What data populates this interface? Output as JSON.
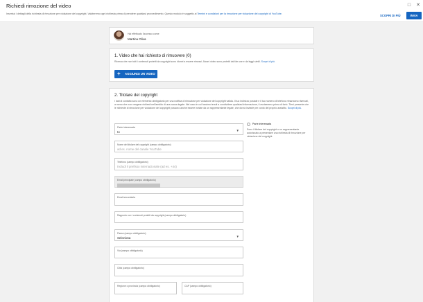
{
  "header": {
    "title": "Richiedi rimozione del video",
    "subtitle": "Inserisci i dettagli della richiesta di rimozione per violazione del copyright. Valuteremo ogni richiesta prima di prendere qualsiasi provvedimento. Questo modulo è soggetto ai ",
    "terms_link": "Termini e condizioni per la rimozione per violazione del copyright di YouTube.",
    "draft_button": "SCOPRI DI PIÙ",
    "submit_button": "INVIA"
  },
  "user": {
    "logged_as": "Hai effettuato l'accesso come",
    "name": "Martina Oliva"
  },
  "section1": {
    "title": "1. Video che hai richiesto di rimuovere (0)",
    "desc": "Ricerca che non tutti i contenuti protetti da copyright sono idonei a essere rimossi. Alcuni video sono protetti dal fair use e da leggi simili. ",
    "more_link": "Scopri di più.",
    "add_button": "AGGIUNGI UN VIDEO"
  },
  "section2": {
    "title": "2. Titolare del copyright",
    "desc": "I dati di contatto sono un elemento obbligatorio per una notifica di rimozione per violazione del copyright valida. Il tuo indirizzo postale e il tuo numero di telefono rimarranno riservati, a meno che non vengano richiesti nell'ambito di una causa legale. Nel caso in cui fossimo tenuti a condividere qualsiasi informazione, ti avviseremo prima di farlo. Tieni presente che le richieste di rimozione per violazione del copyright possono anche essere inviate da un rappresentante legale, che dovrà inviarle per conto del proprio assistito. ",
    "more_link": "Scopri di più.",
    "fields": {
      "affected": {
        "label": "Parte interessata",
        "value": "Io"
      },
      "owner_name": {
        "label": "Nome del titolare del copyright (campo obbligatorio)",
        "placeholder": "ad es. nome del canale YouTube"
      },
      "phone": {
        "label": "Telefono (campo obbligatorio)",
        "placeholder": "Includi il prefisso internazionale (ad es. +44)"
      },
      "email": {
        "label": "Email principale (campo obbligatorio)"
      },
      "email2": {
        "label": "Email secondaria"
      },
      "relation": {
        "label": "Rapporto con i contenuti protetti da copyright (campo obbligatorio)"
      },
      "country": {
        "label": "Paese (campo obbligatorio)",
        "value": "Seleziona"
      },
      "street": {
        "label": "Via (campo obbligatorio)"
      },
      "city": {
        "label": "Città (campo obbligatorio)"
      },
      "region": {
        "label": "Regione o provincia (campo obbligatorio)"
      },
      "zip": {
        "label": "CAP (campo obbligatorio)"
      }
    },
    "side_note": {
      "title": "Parte interessata",
      "desc": "Sono il titolare del copyright o un rappresentante autorizzato a presentare una richiesta di rimozione per violazione del copyright."
    }
  }
}
